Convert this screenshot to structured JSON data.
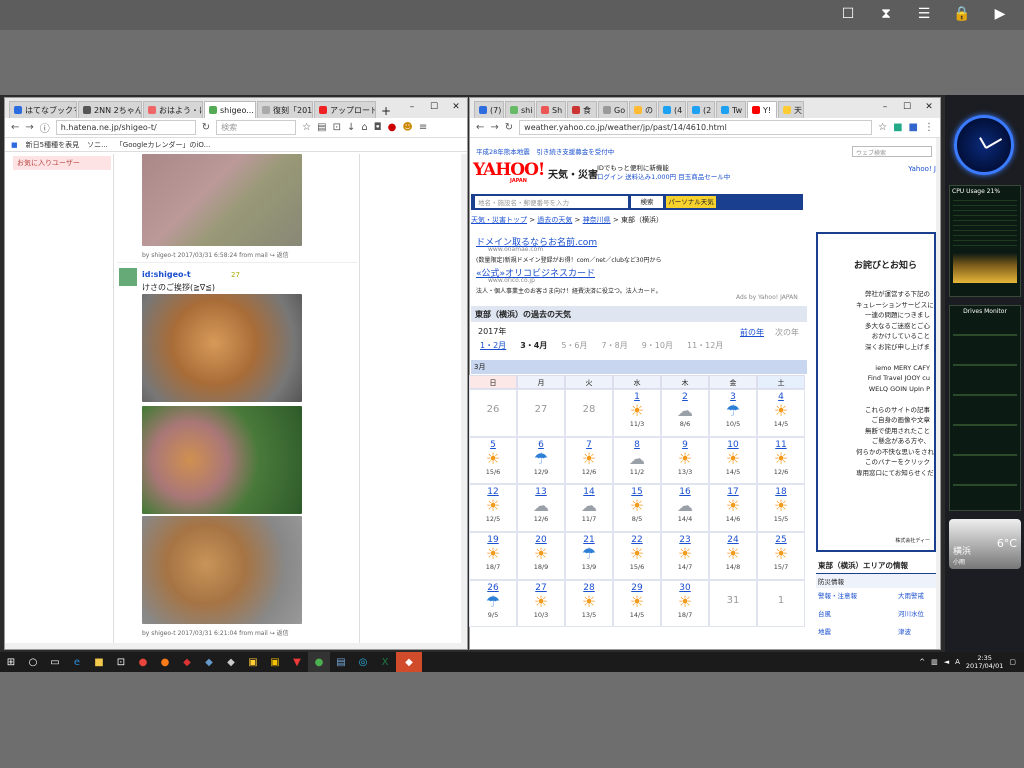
{
  "left_browser": {
    "tabs": [
      "はてなブックマーク...",
      "2NN 2ちゃん...",
      "おはよう・は...",
      "shigeo...",
      "復刻「2017...",
      "アップロード -..."
    ],
    "url": "h.hatena.ne.jp/shigeo-t/",
    "search_placeholder": "検索",
    "bookmarks": [
      "新日5種種を表見",
      "ソニ...",
      "「Googleカレンダー」のiO..."
    ],
    "sidebar_item": "お気に入りユーザー",
    "posts": [
      {
        "meta": "by shigeo-t 2017/03/31 6:58:24 from mail ↪ 返信"
      },
      {
        "author": "id:shigeo-t",
        "star_count": "27",
        "text": "けさのご挨拶(≧∇≦)",
        "meta": "by shigeo-t 2017/03/31 6:21:04 from mail ↪ 返信"
      }
    ]
  },
  "right_browser": {
    "tabs": [
      "(7)",
      "shi",
      "Sh",
      "食",
      "Go",
      "の",
      "(4",
      "(2",
      "Tw",
      "Y!",
      "天"
    ],
    "url": "weather.yahoo.co.jp/weather/jp/past/14/4610.html",
    "search_placeholder": "ウェブ検索",
    "banner": "平成28年熊本地震　引き続き支援募金を受付中",
    "logo": "YAHOO!",
    "logo_sub": "JAPAN",
    "section_title": "天気・災害",
    "promo_line1": "IDでもっと便利に新機能",
    "promo_line2": "ログイン 送料込み1,000円 目玉商品セール中",
    "yahoo_link": "Yahoo! J",
    "search_input_placeholder": "地名・施設名・郵便番号を入力",
    "search_button": "検索",
    "personal_button": "パーソナル天気",
    "breadcrumb": [
      "天気・災害トップ",
      "過去の天気",
      "神奈川県",
      "東部（横浜）"
    ],
    "ads": [
      {
        "title": "ドメイン取るならお名前.com",
        "url": "www.onamae.com",
        "desc": "(数量限定)新規ドメイン登録がお得！com／net／clubなど30円から"
      },
      {
        "title": "«公式»オリコビジネスカード",
        "url": "www.orico.co.jp",
        "desc": "法人・個人事業主のお客さま向け！経費決済に役立つ。法人カード。"
      }
    ],
    "ads_by": "Ads by Yahoo! JAPAN",
    "past_title": "東部（横浜）の過去の天気",
    "year": "2017年",
    "prev_year": "前の年",
    "next_year": "次の年",
    "month_tabs": [
      "1・2月",
      "3・4月",
      "5・6月",
      "7・8月",
      "9・10月",
      "11・12月"
    ],
    "month_label": "3月",
    "weekdays": [
      "日",
      "月",
      "火",
      "水",
      "木",
      "金",
      "土"
    ],
    "calendar": [
      [
        {
          "d": "26",
          "g": true
        },
        {
          "d": "27",
          "g": true
        },
        {
          "d": "28",
          "g": true
        },
        {
          "d": "1",
          "w": "sun",
          "t": "11/3"
        },
        {
          "d": "2",
          "w": "cloud",
          "t": "8/6"
        },
        {
          "d": "3",
          "w": "umb",
          "t": "10/5"
        },
        {
          "d": "4",
          "w": "sun",
          "t": "14/5"
        }
      ],
      [
        {
          "d": "5",
          "w": "sun",
          "t": "15/6"
        },
        {
          "d": "6",
          "w": "umb",
          "t": "12/9"
        },
        {
          "d": "7",
          "w": "sun",
          "t": "12/6"
        },
        {
          "d": "8",
          "w": "cloud",
          "t": "11/2"
        },
        {
          "d": "9",
          "w": "sun",
          "t": "13/3"
        },
        {
          "d": "10",
          "w": "sun",
          "t": "14/5"
        },
        {
          "d": "11",
          "w": "sun",
          "t": "12/6"
        }
      ],
      [
        {
          "d": "12",
          "w": "sun",
          "t": "12/5"
        },
        {
          "d": "13",
          "w": "cloud",
          "t": "12/6"
        },
        {
          "d": "14",
          "w": "cloud",
          "t": "11/7"
        },
        {
          "d": "15",
          "w": "sun",
          "t": "8/5"
        },
        {
          "d": "16",
          "w": "cloud",
          "t": "14/4"
        },
        {
          "d": "17",
          "w": "sun",
          "t": "14/6"
        },
        {
          "d": "18",
          "w": "sun",
          "t": "15/5"
        }
      ],
      [
        {
          "d": "19",
          "w": "sun",
          "t": "18/7"
        },
        {
          "d": "20",
          "w": "sun",
          "t": "18/9"
        },
        {
          "d": "21",
          "w": "umb",
          "t": "13/9"
        },
        {
          "d": "22",
          "w": "sun",
          "t": "15/6"
        },
        {
          "d": "23",
          "w": "sun",
          "t": "14/7"
        },
        {
          "d": "24",
          "w": "sun",
          "t": "14/8"
        },
        {
          "d": "25",
          "w": "sun",
          "t": "15/7"
        }
      ],
      [
        {
          "d": "26",
          "w": "umb",
          "t": "9/5"
        },
        {
          "d": "27",
          "w": "sun",
          "t": "10/3"
        },
        {
          "d": "28",
          "w": "sun",
          "t": "13/5"
        },
        {
          "d": "29",
          "w": "sun",
          "t": "14/5"
        },
        {
          "d": "30",
          "w": "sun",
          "t": "18/7"
        },
        {
          "d": "31",
          "g": true
        },
        {
          "d": "1",
          "g": true
        }
      ]
    ],
    "notice_title": "お詫びとお知ら",
    "notice_lines": [
      "弊社が運営する下記の",
      "キュレーションサービスに",
      "一連の問題につきまし",
      "多大なるご迷惑とご心",
      "おかけしていること",
      "深くお詫び申し上げま",
      "",
      "iemo MERY CAFY",
      "Find Travel JOOY cu",
      "WELQ GOIN UpIn P",
      "",
      "これらのサイトの記事",
      "ご自身の画像や文章",
      "無断で使用されたこと",
      "ご懸念がある方や、",
      "何らかの不快な思いをされ",
      "このバナーをクリック",
      "専用窓口にてお知らせくだ"
    ],
    "company": "株式会社ディー",
    "area_title": "東部（横浜）エリアの情報",
    "area_section": "防災情報",
    "area_links": [
      "警報・注意報",
      "大雨警戒",
      "台風",
      "河川水位",
      "地震",
      "津波"
    ]
  },
  "sidebar": {
    "cpu_title": "CPU Usage  21%",
    "drives_title": "Drives Monitor",
    "weather_city": "横浜",
    "weather_temp": "6°C",
    "weather_desc": "小雨"
  },
  "tray": {
    "time": "2:35",
    "date": "2017/04/01"
  }
}
